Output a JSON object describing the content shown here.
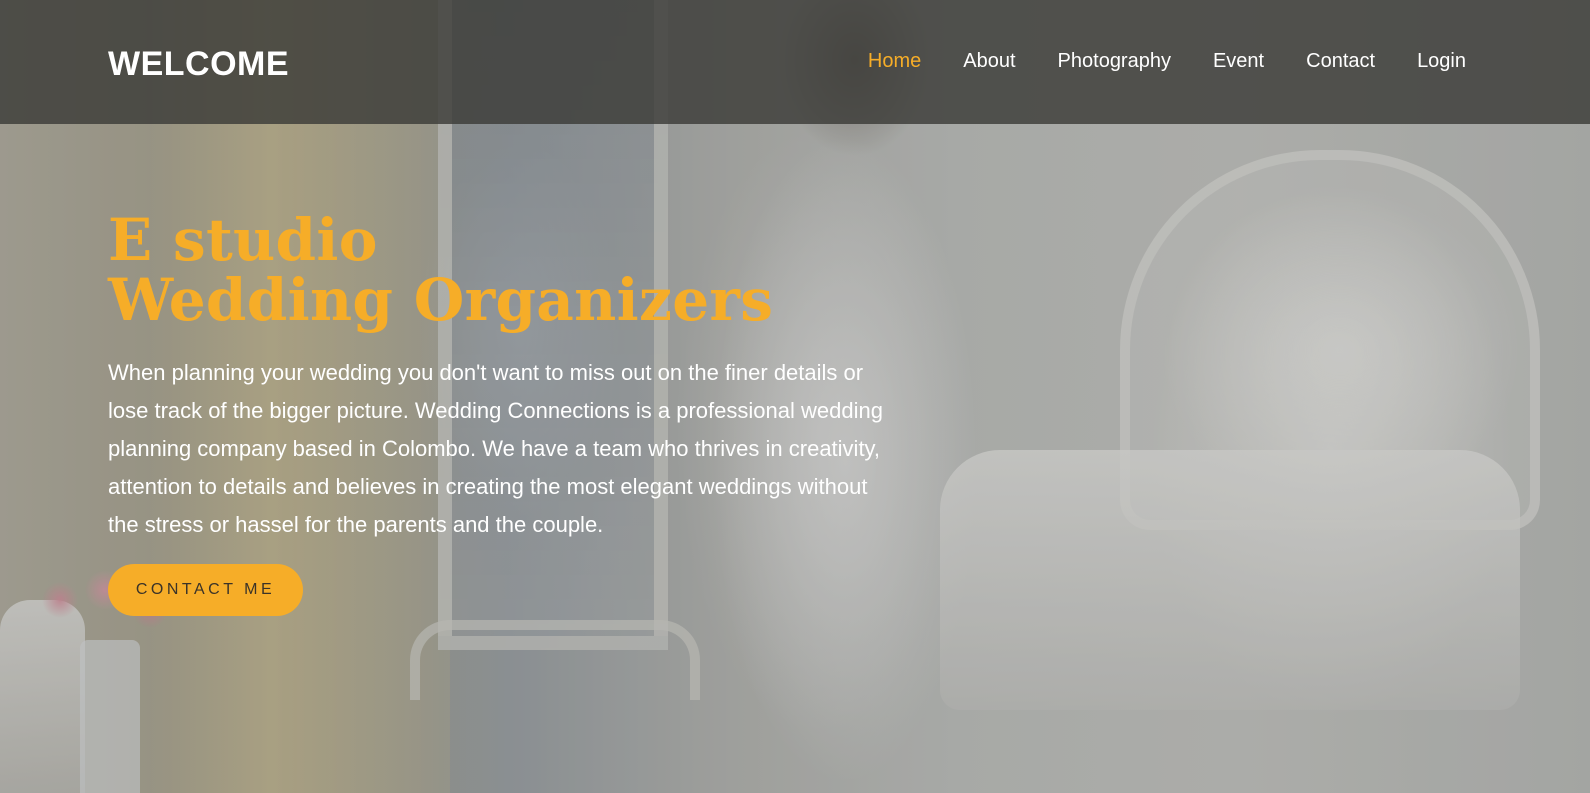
{
  "nav": {
    "brand": "WELCOME",
    "links": [
      {
        "label": "Home",
        "active": true
      },
      {
        "label": "About",
        "active": false
      },
      {
        "label": "Photography",
        "active": false
      },
      {
        "label": "Event",
        "active": false
      },
      {
        "label": "Contact",
        "active": false
      },
      {
        "label": "Login",
        "active": false
      }
    ]
  },
  "hero": {
    "title_line1": "E studio",
    "title_line2": "Wedding Organizers",
    "description": "When planning your wedding you don't want to miss out on the finer details or lose track of the bigger picture. Wedding Connections is a professional wedding planning company based in Colombo. We have a team who thrives in creativity, attention to details and believes in creating the most elegant weddings without the stress or hassel for the parents and the couple.",
    "cta_label": "CONTACT ME"
  },
  "colors": {
    "accent": "#f6ad28",
    "nav_background": "#3c3c38",
    "text_light": "#ffffff"
  }
}
